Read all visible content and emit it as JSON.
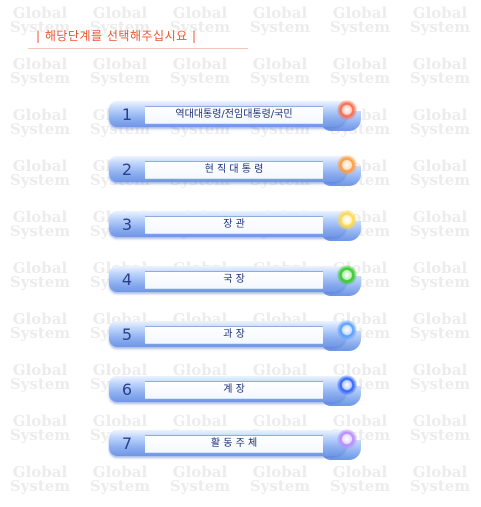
{
  "header": {
    "title": "| 해당단계를 선택해주십시요 |"
  },
  "watermark": {
    "line1": "Global",
    "line2": "System"
  },
  "menu": {
    "items": [
      {
        "number": "1",
        "label": "역대대통령/전임대통령/국민",
        "icon": "glow-orb-icon",
        "color": "#ff6a4a"
      },
      {
        "number": "2",
        "label": "현 직 대 통 령",
        "icon": "glow-orb-icon",
        "color": "#ff9a3c"
      },
      {
        "number": "3",
        "label": "장      관",
        "icon": "glow-orb-icon",
        "color": "#ffd84a"
      },
      {
        "number": "4",
        "label": "국      장",
        "icon": "glow-orb-icon",
        "color": "#36c92a"
      },
      {
        "number": "5",
        "label": "과      장",
        "icon": "glow-orb-icon",
        "color": "#5aa0ff"
      },
      {
        "number": "6",
        "label": "계      장",
        "icon": "glow-orb-icon",
        "color": "#2f66ff"
      },
      {
        "number": "7",
        "label": "활 동 주 체",
        "icon": "glow-orb-icon",
        "color": "#b68cff"
      }
    ]
  }
}
